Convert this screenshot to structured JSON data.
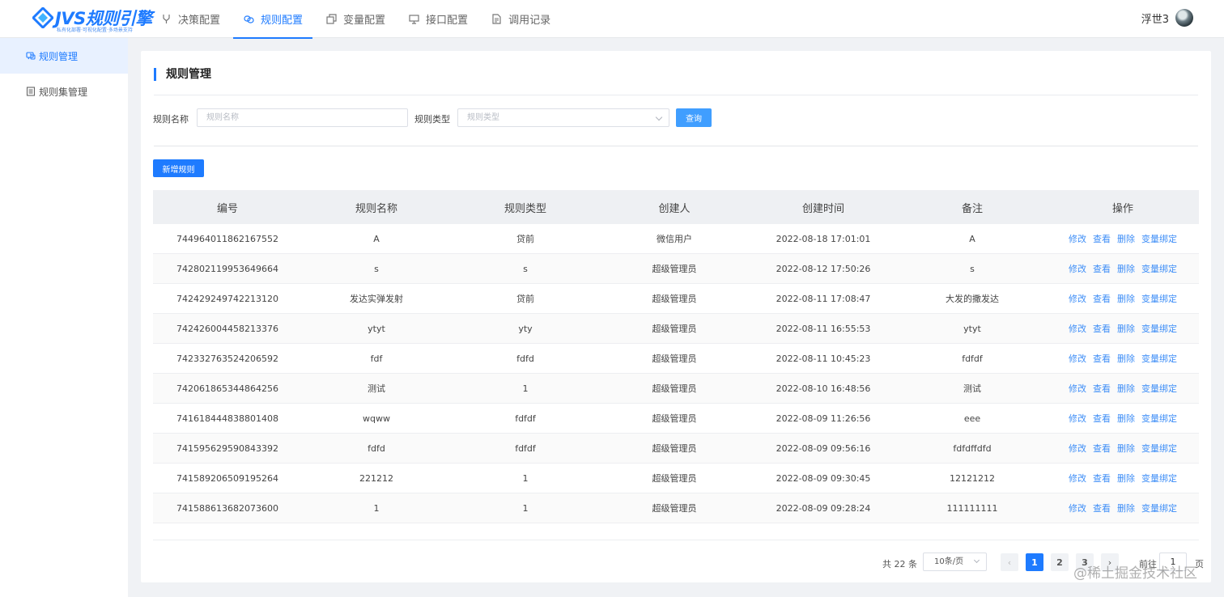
{
  "logo": {
    "text": "JVS规则引擎",
    "sub": "私有化部署·可视化配置·多场景支持"
  },
  "nav": [
    {
      "label": "决策配置",
      "icon": "branch-icon",
      "active": false
    },
    {
      "label": "规则配置",
      "icon": "rules-icon",
      "active": true
    },
    {
      "label": "变量配置",
      "icon": "variables-icon",
      "active": false
    },
    {
      "label": "接口配置",
      "icon": "monitor-icon",
      "active": false
    },
    {
      "label": "调用记录",
      "icon": "document-icon",
      "active": false
    }
  ],
  "user": {
    "name": "浮世3"
  },
  "sidebar": [
    {
      "label": "规则管理",
      "icon": "rule-chat-icon",
      "active": true
    },
    {
      "label": "规则集管理",
      "icon": "list-icon",
      "active": false
    }
  ],
  "page": {
    "title": "规则管理"
  },
  "filters": {
    "name_label": "规则名称",
    "name_placeholder": "规则名称",
    "type_label": "规则类型",
    "type_placeholder": "规则类型",
    "query_button": "查询"
  },
  "toolbar": {
    "new_button": "新增规则"
  },
  "table": {
    "headers": [
      "编号",
      "规则名称",
      "规则类型",
      "创建人",
      "创建时间",
      "备注",
      "操作"
    ],
    "actions": [
      "修改",
      "查看",
      "删除",
      "变量绑定"
    ],
    "rows": [
      [
        "744964011862167552",
        "A",
        "贷前",
        "微信用户",
        "2022-08-18 17:01:01",
        "A"
      ],
      [
        "742802119953649664",
        "s",
        "s",
        "超级管理员",
        "2022-08-12 17:50:26",
        "s"
      ],
      [
        "742429249742213120",
        "发达实弹发射",
        "贷前",
        "超级管理员",
        "2022-08-11 17:08:47",
        "大发的撒发达"
      ],
      [
        "742426004458213376",
        "ytyt",
        "yty",
        "超级管理员",
        "2022-08-11 16:55:53",
        "ytyt"
      ],
      [
        "742332763524206592",
        "fdf",
        "fdfd",
        "超级管理员",
        "2022-08-11 10:45:23",
        "fdfdf"
      ],
      [
        "742061865344864256",
        "测试",
        "1",
        "超级管理员",
        "2022-08-10 16:48:56",
        "测试"
      ],
      [
        "741618444838801408",
        "wqww",
        "fdfdf",
        "超级管理员",
        "2022-08-09 11:26:56",
        "eee"
      ],
      [
        "741595629590843392",
        "fdfd",
        "fdfdf",
        "超级管理员",
        "2022-08-09 09:56:16",
        "fdfdffdfd"
      ],
      [
        "741589206509195264",
        "221212",
        "1",
        "超级管理员",
        "2022-08-09 09:30:45",
        "12121212"
      ],
      [
        "741588613682073600",
        "1",
        "1",
        "超级管理员",
        "2022-08-09 09:28:24",
        "111111111"
      ]
    ]
  },
  "pagination": {
    "total": "共 22 条",
    "page_size": "10条/页",
    "prev": "‹",
    "pages": [
      "1",
      "2",
      "3"
    ],
    "current": "1",
    "next": "›",
    "goto_label": "前往",
    "goto_value": "1",
    "page_suffix": "页"
  },
  "watermark": "@稀土掘金技术社区",
  "colors": {
    "primary": "#1e7bff",
    "query": "#409eff",
    "link": "#3e8ef7",
    "active_bg": "#e8f1ff"
  }
}
